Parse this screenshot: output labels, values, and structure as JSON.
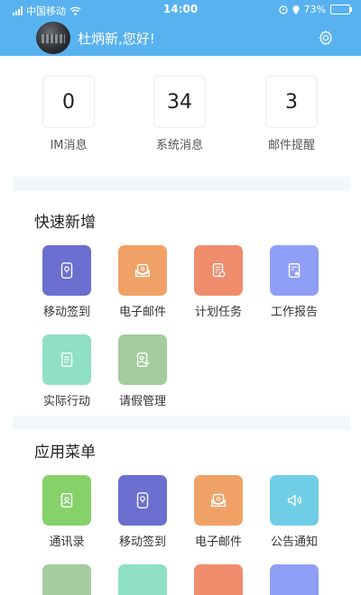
{
  "status_bar": {
    "carrier": "中国移动",
    "time": "14:00",
    "battery": "73%",
    "battery_level": 0.73,
    "icons": [
      "signal-icon",
      "wifi-icon",
      "alarm-icon",
      "battery-icon"
    ]
  },
  "header": {
    "greeting": "杜炳新,您好!",
    "settings_icon": "gear-icon"
  },
  "stats": [
    {
      "value": "0",
      "label": "IM消息"
    },
    {
      "value": "34",
      "label": "系统消息"
    },
    {
      "value": "3",
      "label": "邮件提醒"
    }
  ],
  "quick_add": {
    "title": "快速新增",
    "items": [
      {
        "label": "移动签到",
        "icon": "location-pin-icon",
        "color": "#6b6fcf"
      },
      {
        "label": "电子邮件",
        "icon": "mail-icon",
        "color": "#f0a266"
      },
      {
        "label": "计划任务",
        "icon": "task-icon",
        "color": "#ef8d6d"
      },
      {
        "label": "工作报告",
        "icon": "report-icon",
        "color": "#8f9ef6"
      },
      {
        "label": "实际行动",
        "icon": "document-icon",
        "color": "#8fe0c5"
      },
      {
        "label": "请假管理",
        "icon": "leave-icon",
        "color": "#a4cc9e"
      }
    ]
  },
  "app_menu": {
    "title": "应用菜单",
    "items": [
      {
        "label": "通讯录",
        "icon": "contacts-icon",
        "color": "#86d16a"
      },
      {
        "label": "移动签到",
        "icon": "location-pin-icon",
        "color": "#6b6fcf"
      },
      {
        "label": "电子邮件",
        "icon": "mail-icon",
        "color": "#f0a266"
      },
      {
        "label": "公告通知",
        "icon": "speaker-icon",
        "color": "#6fcde6"
      }
    ],
    "next_row_colors": [
      "#a4cc9e",
      "#8fe0c5",
      "#ef8d6d",
      "#8f9ef6"
    ]
  }
}
